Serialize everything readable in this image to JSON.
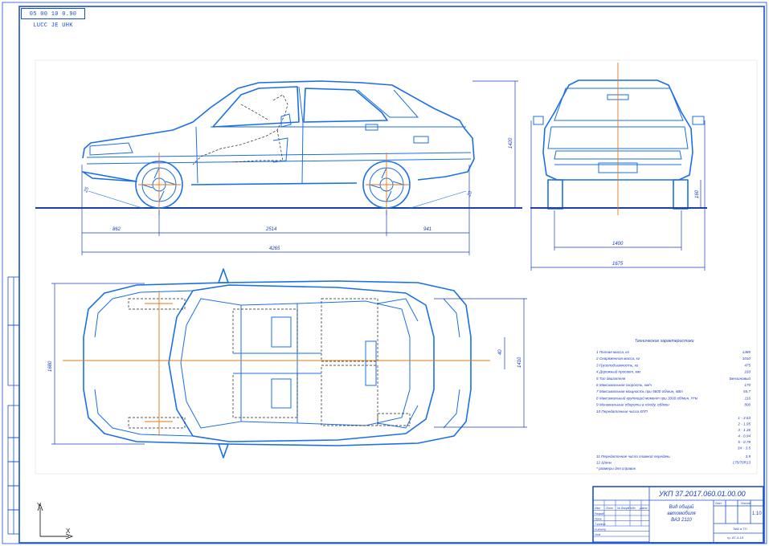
{
  "stamp": "05 00 10 0.90 LUCC JE UHK",
  "dims": {
    "front_overhang": "862",
    "wheelbase": "2514",
    "rear_overhang": "941",
    "overall_length": "4265",
    "height": "1420",
    "clearance": "160",
    "track": "1400",
    "overall_width": "1675",
    "top_width": "1680",
    "top_inner": "1410",
    "top_offset": "40",
    "angle_front": "25",
    "angle_rear": "20"
  },
  "specs": {
    "title": "Технические характеристики",
    "rows": [
      {
        "label": "1 Полная масса, кг",
        "value": "1485"
      },
      {
        "label": "2 Снаряженная масса, кг",
        "value": "1010"
      },
      {
        "label": "3 Грузоподъемность, кг",
        "value": "475"
      },
      {
        "label": "4 Дорожный просвет, мм",
        "value": "160"
      },
      {
        "label": "5 Тип двигателя",
        "value": "Бензиновый"
      },
      {
        "label": "6 Максимальная скорость, км/ч",
        "value": "170"
      },
      {
        "label": "7 Максимальная мощность при 5600 об/мин, кВт",
        "value": "55.7"
      },
      {
        "label": "8 Максимальный крутящий момент при 3000 об/мин, Н*м",
        "value": "116"
      },
      {
        "label": "9 Минимальные обороты в х/ходу, об/мин",
        "value": "800"
      },
      {
        "label": "10 Передаточные числа КПП",
        "value": ""
      }
    ],
    "gears": [
      "1 - 3.63",
      "2 - 1.95",
      "3 - 1.36",
      "4 - 0.94",
      "5 - 0.78",
      "3Х - 3.5"
    ],
    "rows2": [
      {
        "label": "11 Передаточное число главной передачи",
        "value": "3.9"
      },
      {
        "label": "12 Шины",
        "value": "175/70R13"
      },
      {
        "label": "* размеры для справок",
        "value": ""
      }
    ]
  },
  "title_block": {
    "doc_code": "УКП 37.2017.060.01.00.00",
    "name": "Вид общий\nавтомобиля\nВАЗ 2110",
    "scale": "1:10",
    "sheet_label": "Лист",
    "sheets_label": "Листов",
    "cols": [
      "Изм",
      "Лист",
      "№ докум",
      "Подп",
      "Дата"
    ],
    "rows": [
      "Разраб",
      "Пров",
      "Т.контр",
      "Н.контр",
      "Утв"
    ],
    "org": "ЭАК и ТО\nгр. АТ-4-15"
  },
  "axes": {
    "y": "Y",
    "x": "X"
  },
  "colors": {
    "line": "#1a6fe6",
    "frame": "#1a4fd8",
    "axis": "#e07818",
    "ground": "#1e3fa8"
  }
}
